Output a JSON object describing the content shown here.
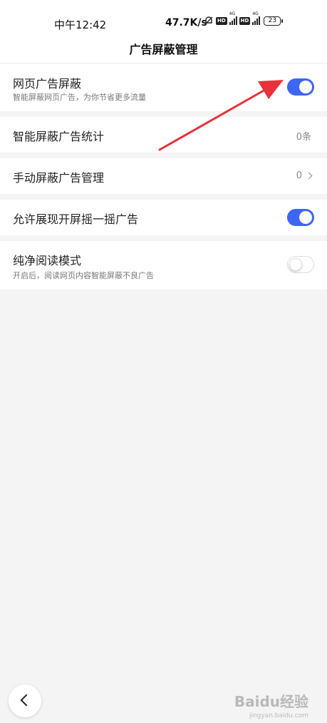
{
  "status_bar": {
    "time": "中午12:42",
    "net_speed": "47.7K/s",
    "hd_label": "HD",
    "signal_label": "4G",
    "battery": "23"
  },
  "header": {
    "title": "广告屏蔽管理"
  },
  "settings": {
    "web_ad_block": {
      "title": "网页广告屏蔽",
      "subtitle": "智能屏蔽网页广告，为你节省更多流量",
      "enabled": true
    },
    "smart_stats": {
      "title": "智能屏蔽广告统计",
      "value": "0条"
    },
    "manual_block": {
      "title": "手动屏蔽广告管理",
      "value": "0"
    },
    "shake_ads": {
      "title": "允许展现开屏摇一摇广告",
      "enabled": true
    },
    "clean_read": {
      "title": "纯净阅读模式",
      "subtitle": "开启后，阅读网页内容智能屏蔽不良广告",
      "enabled": false
    }
  },
  "colors": {
    "accent": "#3d66f5",
    "annotation_arrow": "#e8323c"
  },
  "watermark": {
    "text": "Baidu经验",
    "sub": "jingyan.baidu.com"
  }
}
